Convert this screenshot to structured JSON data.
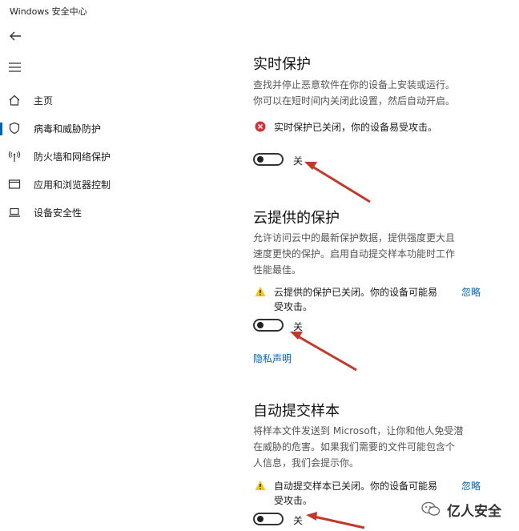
{
  "window": {
    "title": "Windows 安全中心"
  },
  "sidebar": {
    "items": [
      {
        "label": "主页",
        "icon": "home-icon"
      },
      {
        "label": "病毒和威胁防护",
        "icon": "shield-icon",
        "active": true
      },
      {
        "label": "防火墙和网络保护",
        "icon": "antenna-icon"
      },
      {
        "label": "应用和浏览器控制",
        "icon": "browser-window-icon"
      },
      {
        "label": "设备安全性",
        "icon": "laptop-icon"
      }
    ]
  },
  "realtime": {
    "title": "实时保护",
    "desc_line1": "查找并停止恶意软件在你的设备上安装或运行。",
    "desc_line2": "你可以在短时间内关闭此设置，然后自动开启。",
    "status": "实时保护已关闭，你的设备易受攻击。",
    "toggle_label": "关",
    "toggle_on": false
  },
  "cloud": {
    "title": "云提供的保护",
    "desc_line1": "允许访问云中的最新保护数据，提供强度更大且",
    "desc_line2": "速度更快的保护。启用自动提交样本功能时工作",
    "desc_line3": "性能最佳。",
    "status_line1": "云提供的保护已关闭。你的设备可能易",
    "status_line2": "受攻击。",
    "ignore": "忽略",
    "toggle_label": "关",
    "toggle_on": false,
    "privacy_link": "隐私声明"
  },
  "sample": {
    "title": "自动提交样本",
    "desc_line1": "将样本文件发送到 Microsoft，让你和他人免受潜",
    "desc_line2": "在威胁的危害。如果我们需要的文件可能包含个",
    "desc_line3": "人信息，我们会提示你。",
    "status_line1": "自动提交样本已关闭。你的设备可能易",
    "status_line2": "受攻击。",
    "ignore": "忽略",
    "toggle_label": "关",
    "toggle_on": false
  },
  "watermark": {
    "text": "亿人安全"
  },
  "colors": {
    "accent": "#0063b1",
    "error": "#d13438",
    "warning": "#f2c811",
    "annotation": "#c0392b"
  }
}
